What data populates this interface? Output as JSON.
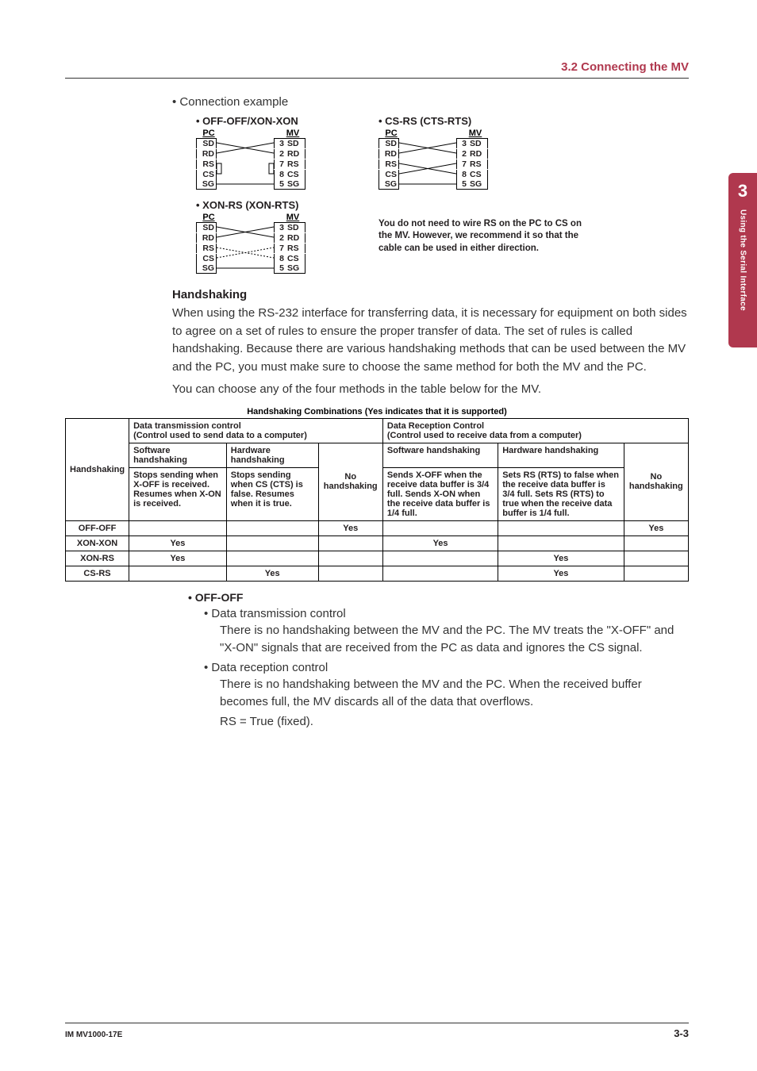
{
  "header": {
    "section": "3.2  Connecting the MV"
  },
  "sidebar": {
    "chapter": "3",
    "title": "Using the Serial Interface"
  },
  "intro": {
    "bullet": "•   Connection example"
  },
  "diagrams": {
    "diag1": {
      "title": "• OFF-OFF/XON-XON",
      "pc_label": "PC",
      "mv_label": "MV",
      "rows": [
        {
          "pc": "SD",
          "num": "3",
          "mv": "SD"
        },
        {
          "pc": "RD",
          "num": "2",
          "mv": "RD"
        },
        {
          "pc": "RS",
          "num": "7",
          "mv": "RS"
        },
        {
          "pc": "CS",
          "num": "8",
          "mv": "CS"
        },
        {
          "pc": "SG",
          "num": "5",
          "mv": "SG"
        }
      ]
    },
    "diag2": {
      "title": "• CS-RS (CTS-RTS)",
      "pc_label": "PC",
      "mv_label": "MV",
      "rows": [
        {
          "pc": "SD",
          "num": "3",
          "mv": "SD"
        },
        {
          "pc": "RD",
          "num": "2",
          "mv": "RD"
        },
        {
          "pc": "RS",
          "num": "7",
          "mv": "RS"
        },
        {
          "pc": "CS",
          "num": "8",
          "mv": "CS"
        },
        {
          "pc": "SG",
          "num": "5",
          "mv": "SG"
        }
      ]
    },
    "diag3": {
      "title": "• XON-RS (XON-RTS)",
      "pc_label": "PC",
      "mv_label": "MV",
      "rows": [
        {
          "pc": "SD",
          "num": "3",
          "mv": "SD"
        },
        {
          "pc": "RD",
          "num": "2",
          "mv": "RD"
        },
        {
          "pc": "RS",
          "num": "7",
          "mv": "RS"
        },
        {
          "pc": "CS",
          "num": "8",
          "mv": "CS"
        },
        {
          "pc": "SG",
          "num": "5",
          "mv": "SG"
        }
      ]
    },
    "sidenote": "You do not need to wire RS on the PC to CS on the MV.  However, we recommend it so that the cable can be used in either direction."
  },
  "handshaking": {
    "title": "Handshaking",
    "p1": "When using the RS-232 interface for transferring data, it is necessary for equipment on both sides to agree on a set of rules to ensure the proper transfer of data. The set of rules is called handshaking. Because there are various handshaking methods that can be used between the MV and the PC, you must make sure to choose the same method for both the MV and the PC.",
    "p2": "You can choose any of the four methods in the table below for the MV."
  },
  "table": {
    "caption": "Handshaking Combinations (Yes indicates that it is supported)",
    "h_tx": "Data transmission control",
    "h_tx_sub": "(Control used to send data to a computer)",
    "h_rx": "Data Reception Control",
    "h_rx_sub": "(Control used to receive data from a computer)",
    "col_sw": "Software handshaking",
    "col_hw": "Hardware handshaking",
    "col_no": "No handshaking",
    "row_label": "Handshaking",
    "tx_sw": "Stops sending when X-OFF is received.  Resumes when X-ON is received.",
    "tx_hw": "Stops sending when CS (CTS) is false. Resumes when it is true.",
    "rx_sw": "Sends X-OFF when the receive data buffer is 3/4 full.  Sends X-ON when the receive data buffer is 1/4 full.",
    "rx_hw": "Sets RS (RTS) to false when the receive data buffer is 3/4 full.  Sets RS (RTS) to true when the receive data buffer is 1/4 full.",
    "rows": [
      {
        "name": "OFF-OFF",
        "tx_sw": "",
        "tx_hw": "",
        "tx_no": "Yes",
        "rx_sw": "",
        "rx_hw": "",
        "rx_no": "Yes"
      },
      {
        "name": "XON-XON",
        "tx_sw": "Yes",
        "tx_hw": "",
        "tx_no": "",
        "rx_sw": "Yes",
        "rx_hw": "",
        "rx_no": ""
      },
      {
        "name": "XON-RS",
        "tx_sw": "Yes",
        "tx_hw": "",
        "tx_no": "",
        "rx_sw": "",
        "rx_hw": "Yes",
        "rx_no": ""
      },
      {
        "name": "CS-RS",
        "tx_sw": "",
        "tx_hw": "Yes",
        "tx_no": "",
        "rx_sw": "",
        "rx_hw": "Yes",
        "rx_no": ""
      }
    ]
  },
  "offoff": {
    "title": "•   OFF-OFF",
    "b1": "•   Data transmission control",
    "t1": "There is no handshaking between the MV and the PC. The MV treats the \"X-OFF\" and \"X-ON\" signals that are received from the PC as data and ignores the CS signal.",
    "b2": "•   Data reception control",
    "t2": "There is no handshaking between the MV and the PC. When the received buffer becomes full, the MV discards all of the data that overflows.",
    "t3": "RS = True (fixed)."
  },
  "footer": {
    "left": "IM MV1000-17E",
    "right": "3-3"
  }
}
